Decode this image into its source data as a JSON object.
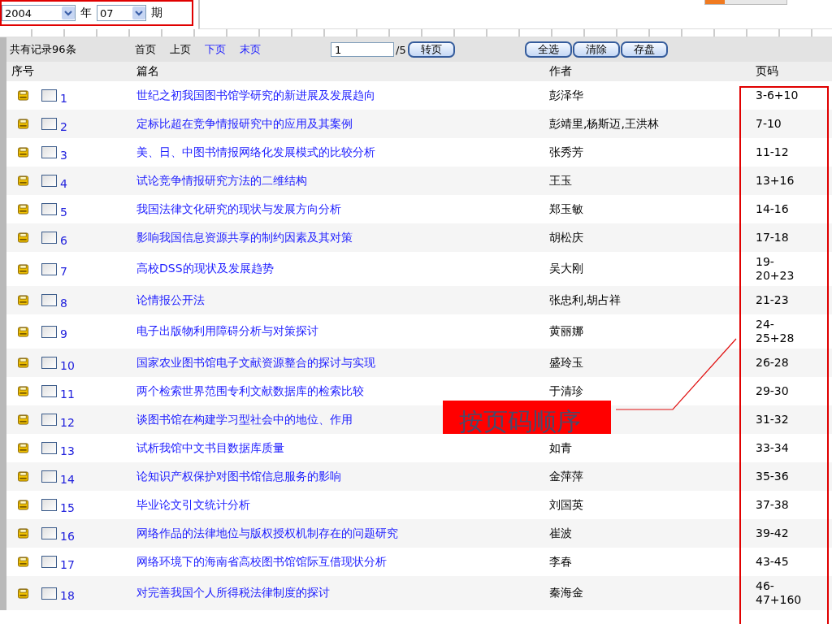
{
  "issue_picker": {
    "year": "2004",
    "year_label": "年",
    "issue": "07",
    "issue_label": "期"
  },
  "toolbar": {
    "record_count": "共有记录96条",
    "pager": [
      {
        "label": "首页",
        "disabled": true
      },
      {
        "label": "上页",
        "disabled": true
      },
      {
        "label": "下页",
        "disabled": false
      },
      {
        "label": "末页",
        "disabled": false
      }
    ],
    "page_input": "1",
    "page_total": "/5",
    "go_button": "转页",
    "actions": [
      "全选",
      "清除",
      "存盘"
    ]
  },
  "table": {
    "columns": [
      "序号",
      "篇名",
      "作者",
      "页码"
    ],
    "rows": [
      {
        "no": "1",
        "checked": false,
        "title": "世纪之初我国图书馆学研究的新进展及发展趋向",
        "author": "彭泽华",
        "pages": "3-6+10"
      },
      {
        "no": "2",
        "checked": false,
        "title": "定标比超在竞争情报研究中的应用及其案例",
        "author": "彭靖里,杨斯迈,王洪林",
        "pages": "7-10"
      },
      {
        "no": "3",
        "checked": false,
        "title": "美、日、中图书情报网络化发展模式的比较分析",
        "author": "张秀芳",
        "pages": "11-12"
      },
      {
        "no": "4",
        "checked": false,
        "title": "试论竞争情报研究方法的二维结构",
        "author": "王玉",
        "pages": "13+16"
      },
      {
        "no": "5",
        "checked": false,
        "title": "我国法律文化研究的现状与发展方向分析",
        "author": "郑玉敏",
        "pages": "14-16"
      },
      {
        "no": "6",
        "checked": false,
        "title": "影响我国信息资源共享的制约因素及其对策",
        "author": "胡松庆",
        "pages": "17-18"
      },
      {
        "no": "7",
        "checked": false,
        "title": "高校DSS的现状及发展趋势",
        "author": "吴大刚",
        "pages": "19-20+23"
      },
      {
        "no": "8",
        "checked": false,
        "title": "论情报公开法",
        "author": "张忠利,胡占祥",
        "pages": "21-23"
      },
      {
        "no": "9",
        "checked": false,
        "title": "电子出版物利用障碍分析与对策探讨",
        "author": "黄丽娜",
        "pages": "24-25+28"
      },
      {
        "no": "10",
        "checked": false,
        "title": "国家农业图书馆电子文献资源整合的探讨与实现",
        "author": "盛玲玉",
        "pages": "26-28"
      },
      {
        "no": "11",
        "checked": false,
        "title": "两个检索世界范围专利文献数据库的检索比较",
        "author": "于清珍",
        "pages": "29-30"
      },
      {
        "no": "12",
        "checked": false,
        "title": "谈图书馆在构建学习型社会中的地位、作用",
        "pages": "31-32"
      },
      {
        "no": "13",
        "checked": false,
        "title": "试析我馆中文书目数据库质量",
        "author": "如青",
        "pages": "33-34"
      },
      {
        "no": "14",
        "checked": false,
        "title": "论知识产权保护对图书馆信息服务的影响",
        "author": "金萍萍",
        "pages": "35-36"
      },
      {
        "no": "15",
        "checked": false,
        "title": "毕业论文引文统计分析",
        "author": "刘国英",
        "pages": "37-38"
      },
      {
        "no": "16",
        "checked": false,
        "title": "网络作品的法律地位与版权授权机制存在的问题研究",
        "author": "崔波",
        "pages": "39-42"
      },
      {
        "no": "17",
        "checked": false,
        "title": "网络环境下的海南省高校图书馆馆际互借现状分析",
        "author": "李春",
        "pages": "43-45"
      },
      {
        "no": "18",
        "checked": false,
        "title": "对完善我国个人所得税法律制度的探讨",
        "author": "秦海金",
        "pages": "46-47+160"
      }
    ]
  },
  "annotation": {
    "label": "按页码顺序"
  }
}
